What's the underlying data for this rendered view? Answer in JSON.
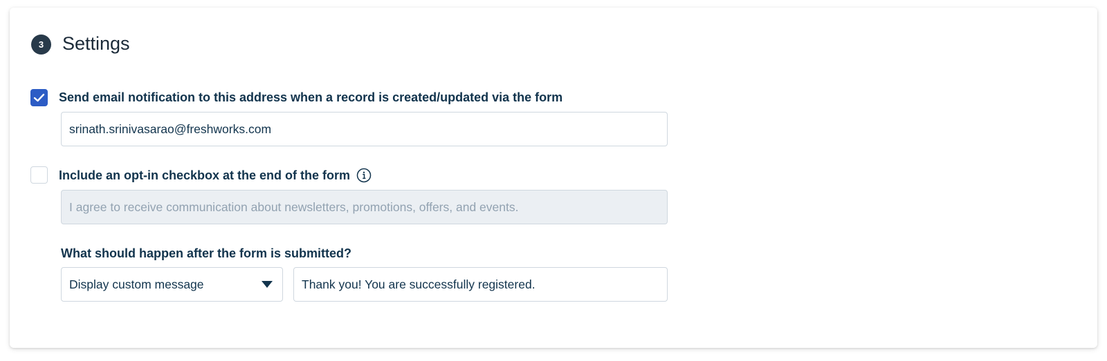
{
  "section": {
    "step_number": "3",
    "title": "Settings"
  },
  "email_notification": {
    "checked": true,
    "label": "Send email notification to this address when a record is created/updated via the form",
    "email_value": "srinath.srinivasarao@freshworks.com"
  },
  "opt_in": {
    "checked": false,
    "label": "Include an opt-in checkbox at the end of the form",
    "info_icon": "info-icon",
    "text_value": "I agree to receive communication about newsletters, promotions, offers, and events."
  },
  "after_submit": {
    "question": "What should happen after the form is submitted?",
    "selected_action": "Display custom message",
    "message_value": "Thank you! You are successfully registered."
  },
  "colors": {
    "accent": "#2c5cc5",
    "badge": "#283a4a",
    "text": "#12344d",
    "border": "#cfd7df",
    "disabled_bg": "#ebeff3"
  }
}
